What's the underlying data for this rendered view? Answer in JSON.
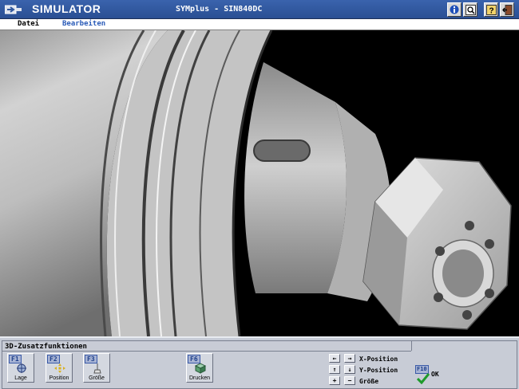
{
  "titlebar": {
    "app_title": "SIMULATOR",
    "window_title": "SYMplus - SIN840DC",
    "buttons": [
      "info-icon",
      "zoom-window-icon",
      "help-icon",
      "exit-icon"
    ]
  },
  "menu": {
    "items": [
      "Datei",
      "Bearbeiten"
    ]
  },
  "panel": {
    "title": "3D-Zusatzfunktionen",
    "softkeys": [
      {
        "key": "F1",
        "label": "Lage",
        "icon": "orientation-icon"
      },
      {
        "key": "F2",
        "label": "Position",
        "icon": "move-icon"
      },
      {
        "key": "F3",
        "label": "Größe",
        "icon": "size-icon"
      },
      {
        "key": "F6",
        "label": "Drucken",
        "icon": "print-cube-icon"
      }
    ],
    "nav": {
      "left": "←",
      "right": "→",
      "up": "↑",
      "down": "↓",
      "plus": "+",
      "minus": "−",
      "x_label": "X-Position",
      "y_label": "Y-Position",
      "size_label": "Größe"
    },
    "ok": {
      "key": "F10",
      "label": "OK",
      "icon": "check-icon"
    }
  },
  "colors": {
    "titlebar": "#2f579e",
    "panel": "#c6cbd6",
    "active_menu": "#2a5bb8"
  }
}
